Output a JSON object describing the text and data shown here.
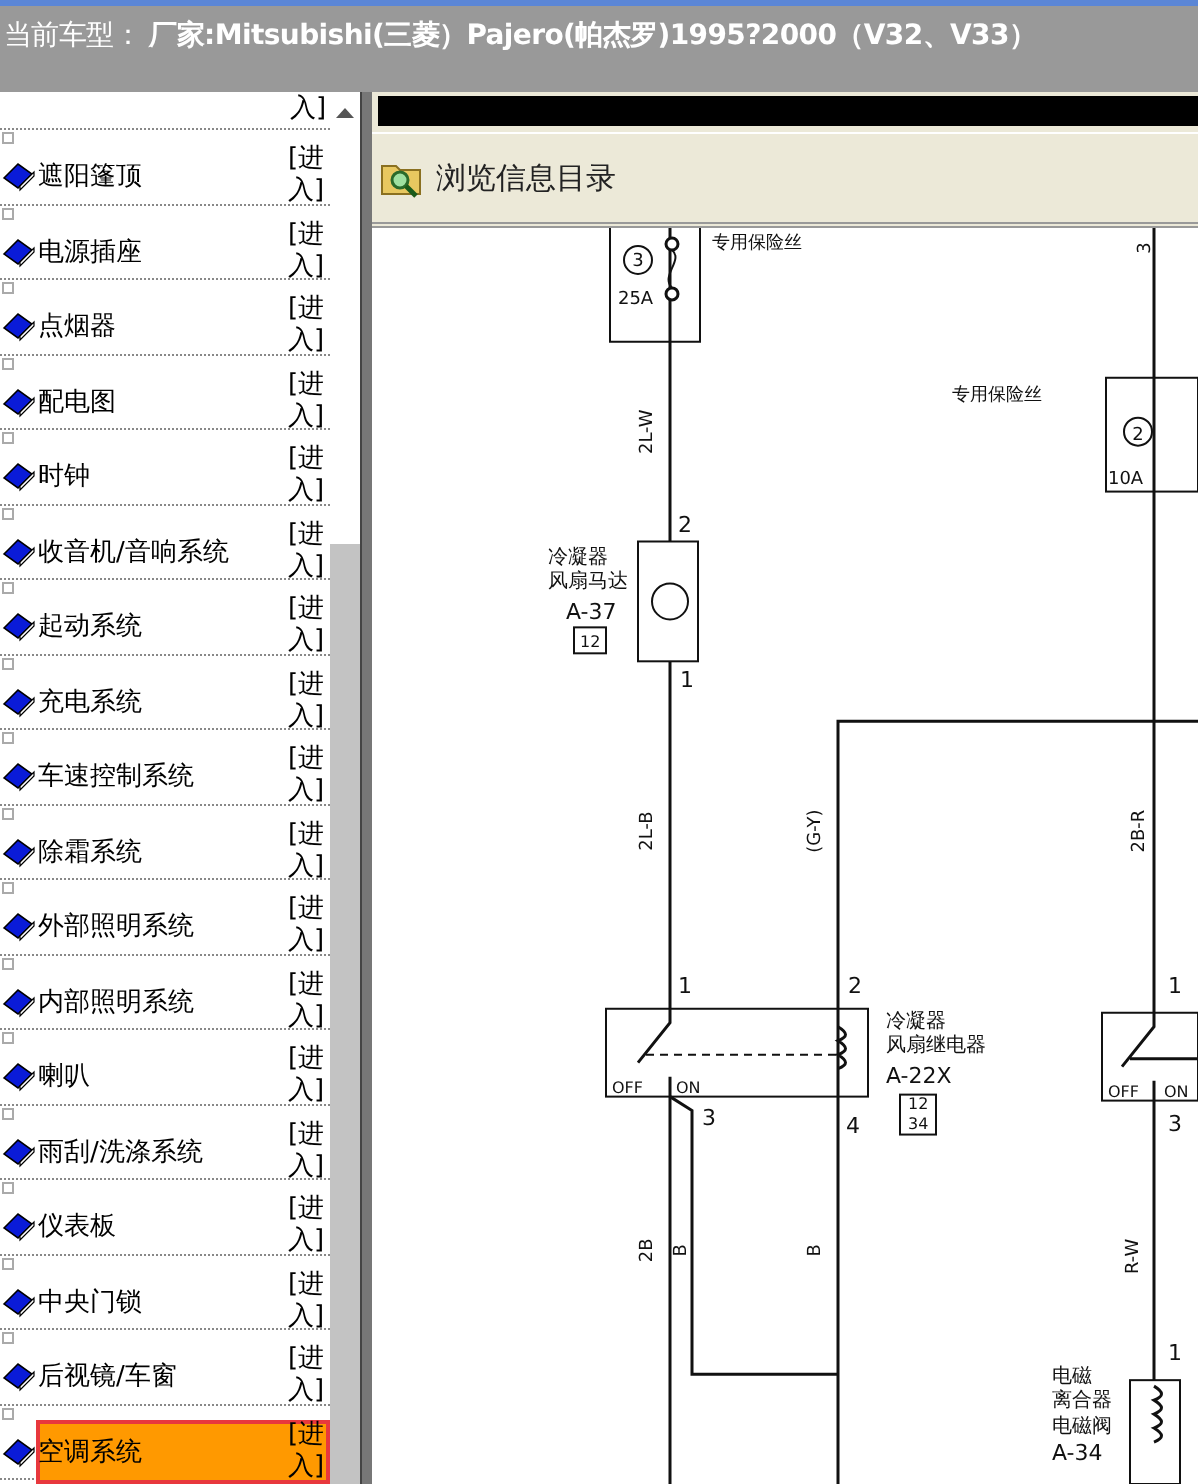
{
  "title_bar": {
    "text": "当前车型： **厂家:Mitsubishi(三菱）Pajero(帕杰罗)1995?2000（V32、V33）**"
  },
  "sidebar": {
    "cut_link": "入]",
    "items": [
      {
        "label": "遮阳篷顶",
        "link": "[进入]",
        "selected": false
      },
      {
        "label": "电源插座",
        "link": "[进入]",
        "selected": false
      },
      {
        "label": "点烟器",
        "link": "[进入]",
        "selected": false
      },
      {
        "label": "配电图",
        "link": "[进入]",
        "selected": false
      },
      {
        "label": "时钟",
        "link": "[进入]",
        "selected": false
      },
      {
        "label": "收音机/音响系统",
        "link": "[进入]",
        "selected": false
      },
      {
        "label": "起动系统",
        "link": "[进入]",
        "selected": false
      },
      {
        "label": "充电系统",
        "link": "[进入]",
        "selected": false
      },
      {
        "label": "车速控制系统",
        "link": "[进入]",
        "selected": false
      },
      {
        "label": "除霜系统",
        "link": "[进入]",
        "selected": false
      },
      {
        "label": "外部照明系统",
        "link": "[进入]",
        "selected": false
      },
      {
        "label": "内部照明系统",
        "link": "[进入]",
        "selected": false
      },
      {
        "label": "喇叭",
        "link": "[进入]",
        "selected": false
      },
      {
        "label": "雨刮/洗涤系统",
        "link": "[进入]",
        "selected": false
      },
      {
        "label": "仪表板",
        "link": "[进入]",
        "selected": false
      },
      {
        "label": "中央门锁",
        "link": "[进入]",
        "selected": false
      },
      {
        "label": "后视镜/车窗",
        "link": "[进入]",
        "selected": false
      },
      {
        "label": "空调系统",
        "link": "[进入]",
        "selected": true
      }
    ]
  },
  "toolbar": {
    "label": "浏览信息目录"
  },
  "diagram": {
    "labels": [
      "专用保险丝",
      "3",
      "25A",
      "3",
      "2L-W",
      "专用保险丝",
      "2",
      "10A",
      "2",
      "冷凝器",
      "风扇马达",
      "A-37",
      "12",
      "1",
      "2L-B",
      "(G-Y)",
      "2B-R",
      "1",
      "2",
      "冷凝器",
      "风扇继电器",
      "A-22X",
      "12",
      "34",
      "OFF",
      "ON",
      "3",
      "4",
      "2B",
      "B",
      "B",
      "1",
      "OFF",
      "ON",
      "3",
      "R-W",
      "1",
      "电磁",
      "离合器",
      "电磁阀",
      "A-34"
    ]
  }
}
